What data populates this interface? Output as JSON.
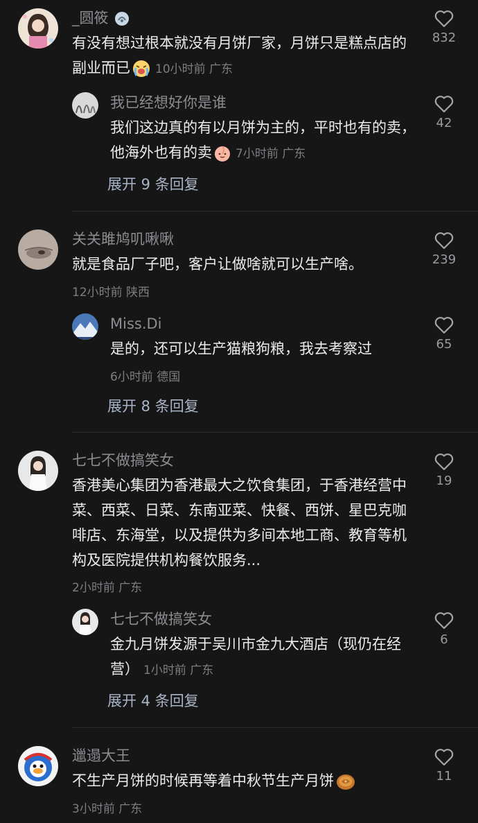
{
  "comments": [
    {
      "user": "_圆筱",
      "text": "有没有想过根本就没有月饼厂家，月饼只是糕点店的副业而已",
      "time": "10小时前",
      "location": "广东",
      "likes": "832",
      "reply": {
        "user": "我已经想好你是谁",
        "text": "我们这边真的有以月饼为主的，平时也有的卖，他海外也有的卖",
        "time": "7小时前",
        "location": "广东",
        "likes": "42"
      },
      "expand": "展开 9 条回复"
    },
    {
      "user": "关关雎鸠叽啾啾",
      "text": "就是食品厂子吧，客户让做啥就可以生产啥。",
      "time": "12小时前",
      "location": "陕西",
      "likes": "239",
      "reply": {
        "user": "Miss.Di",
        "text": "是的，还可以生产猫粮狗粮，我去考察过",
        "time": "6小时前",
        "location": "德国",
        "likes": "65"
      },
      "expand": "展开 8 条回复"
    },
    {
      "user": "七七不做搞笑女",
      "text": "香港美心集团为香港最大之饮食集团，于香港经营中菜、西菜、日菜、东南亚菜、快餐、西饼、星巴克咖啡店、东海堂，以及提供为多间本地工商、教育等机构及医院提供机构餐饮服务...",
      "time": "2小时前",
      "location": "广东",
      "likes": "19",
      "reply": {
        "user": "七七不做搞笑女",
        "text": "金九月饼发源于吴川市金九大酒店（现仍在经营）",
        "time": "1小时前",
        "location": "广东",
        "likes": "6"
      },
      "expand": "展开 4 条回复"
    },
    {
      "user": "邋遢大王",
      "text": "不生产月饼的时候再等着中秋节生产月饼",
      "time": "3小时前",
      "location": "广东",
      "likes": "11"
    }
  ],
  "colors": {
    "background": "#161617",
    "text": "#ececee",
    "muted": "#7d7d82",
    "expand": "#a9b4c6"
  },
  "icons": {
    "like": "heart-outline-icon",
    "emoji_crying": "crying-face-emoji",
    "emoji_peach": "peach-face-emoji",
    "emoji_mooncake": "mooncake-emoji",
    "name_badge": "badge-icon"
  }
}
